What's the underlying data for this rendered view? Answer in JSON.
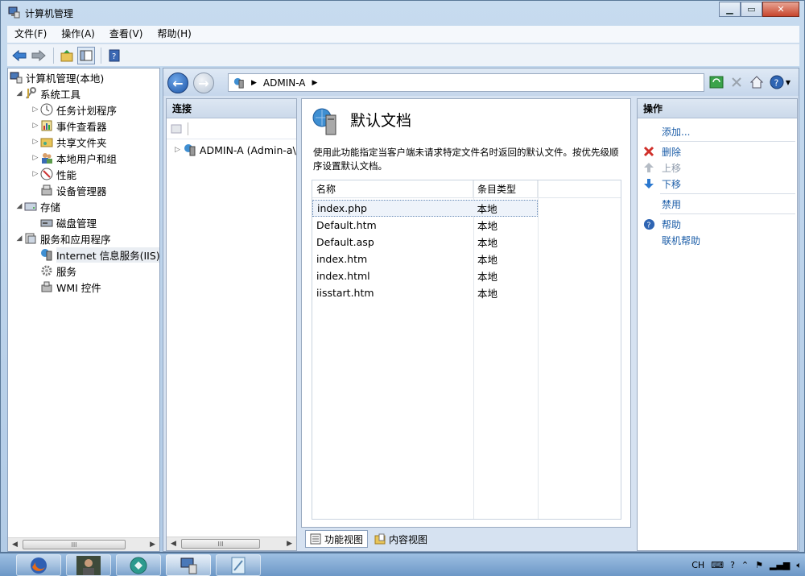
{
  "window": {
    "title": "计算机管理"
  },
  "menu": [
    "文件(F)",
    "操作(A)",
    "查看(V)",
    "帮助(H)"
  ],
  "tree": {
    "root": "计算机管理(本地)",
    "items": [
      {
        "label": "系统工具"
      },
      {
        "label": "任务计划程序"
      },
      {
        "label": "事件查看器"
      },
      {
        "label": "共享文件夹"
      },
      {
        "label": "本地用户和组"
      },
      {
        "label": "性能"
      },
      {
        "label": "设备管理器"
      },
      {
        "label": "存储"
      },
      {
        "label": "磁盘管理"
      },
      {
        "label": "服务和应用程序"
      },
      {
        "label": "Internet 信息服务(IIS)管"
      },
      {
        "label": "服务"
      },
      {
        "label": "WMI 控件"
      }
    ]
  },
  "scroll": {
    "thumb_glyph": "III"
  },
  "address": {
    "segment": "ADMIN-A"
  },
  "connections": {
    "header": "连接",
    "node": "ADMIN-A (Admin-a\\"
  },
  "feature": {
    "title": "默认文档",
    "description": "使用此功能指定当客户端未请求特定文件名时返回的默认文件。按优先级顺序设置默认文档。",
    "columns": {
      "name": "名称",
      "type": "条目类型"
    },
    "rows": [
      {
        "name": "index.php",
        "type": "本地"
      },
      {
        "name": "Default.htm",
        "type": "本地"
      },
      {
        "name": "Default.asp",
        "type": "本地"
      },
      {
        "name": "index.htm",
        "type": "本地"
      },
      {
        "name": "index.html",
        "type": "本地"
      },
      {
        "name": "iisstart.htm",
        "type": "本地"
      }
    ]
  },
  "views": {
    "features": "功能视图",
    "content": "内容视图"
  },
  "actions": {
    "header": "操作",
    "add": "添加...",
    "remove": "删除",
    "move_up": "上移",
    "move_down": "下移",
    "disable": "禁用",
    "help": "帮助",
    "online_help": "联机帮助"
  },
  "tray": {
    "lang": "CH"
  }
}
